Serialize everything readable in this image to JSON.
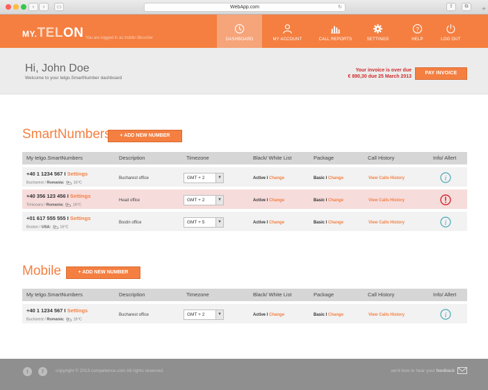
{
  "browser": {
    "url": "WebApp.com"
  },
  "brand": {
    "prefix": "MY.",
    "name_a": "TEL",
    "name_b": "ON",
    "tagline": "You are logged in as trublin ilbrucher"
  },
  "nav": [
    {
      "label": "DASHBOARD",
      "icon": "clock-icon"
    },
    {
      "label": "MY ACCOUNT",
      "icon": "user-icon"
    },
    {
      "label": "CALL REPORTS",
      "icon": "bar-chart-icon"
    },
    {
      "label": "SETTINGS",
      "icon": "gear-icon"
    },
    {
      "label": "HELP",
      "icon": "help-icon"
    },
    {
      "label": "LOG OUT",
      "icon": "power-icon"
    }
  ],
  "hero": {
    "greeting": "Hi, John Doe",
    "subtitle": "Welcome to your telgo.SmartNumber dashboard",
    "invoice_line1": "Your invoice is over due",
    "invoice_line2": "€ 890,30 due 25 March 2013",
    "pay_label": "PAY INVOICE"
  },
  "columns": [
    "My telgo.SmartNumbers",
    "Description",
    "Timezone",
    "Black/ White List",
    "Package",
    "Call History",
    "Info/ Allert"
  ],
  "smart": {
    "title": "SmartNumbers",
    "add_label": "+ ADD NEW NUMBER",
    "rows": [
      {
        "number": "+40 1 1234 567",
        "settings": "Settings",
        "city": "Bucharest",
        "country": "Romania:",
        "temp": "16°C",
        "desc": "Bucharest office",
        "tz": "GMT + 2",
        "bw": "Active",
        "bw_change": "Change",
        "pkg": "Basic",
        "pkg_change": "Change",
        "history": "View Calls History",
        "status": "info"
      },
      {
        "number": "+40 356 123 456",
        "settings": "Settings",
        "city": "Timisoara",
        "country": "Romania:",
        "temp": "16°C",
        "desc": "Head office",
        "tz": "GMT + 2",
        "bw": "Active",
        "bw_change": "Change",
        "pkg": "Basic",
        "pkg_change": "Change",
        "history": "View Calls History",
        "status": "alert"
      },
      {
        "number": "+01 617 555 555",
        "settings": "Settings",
        "city": "Boston",
        "country": "USA:",
        "temp": "16°C",
        "desc": "Bostin office",
        "tz": "GMT + 5",
        "bw": "Active",
        "bw_change": "Change",
        "pkg": "Basic",
        "pkg_change": "Change",
        "history": "View Calls History",
        "status": "info"
      }
    ]
  },
  "mobile": {
    "title": "Mobile",
    "add_label": "+ ADD NEW NUMBER",
    "rows": [
      {
        "number": "+40 1 1234 567",
        "settings": "Settings",
        "city": "Bucharest",
        "country": "Romania:",
        "temp": "16°C",
        "desc": "Bucharest office",
        "tz": "GMT + 2",
        "bw": "Active",
        "bw_change": "Change",
        "pkg": "Basic",
        "pkg_change": "Change",
        "history": "View Calls History",
        "status": "info"
      }
    ]
  },
  "footer": {
    "copyright": "copyright © 2013 competence.com All rights reserved.",
    "feedback_prefix": "we'd love to hear your ",
    "feedback_link": "feedback"
  },
  "colors": {
    "accent": "#f47f41",
    "alert": "#d12a2a",
    "info": "#4aa8b8"
  }
}
